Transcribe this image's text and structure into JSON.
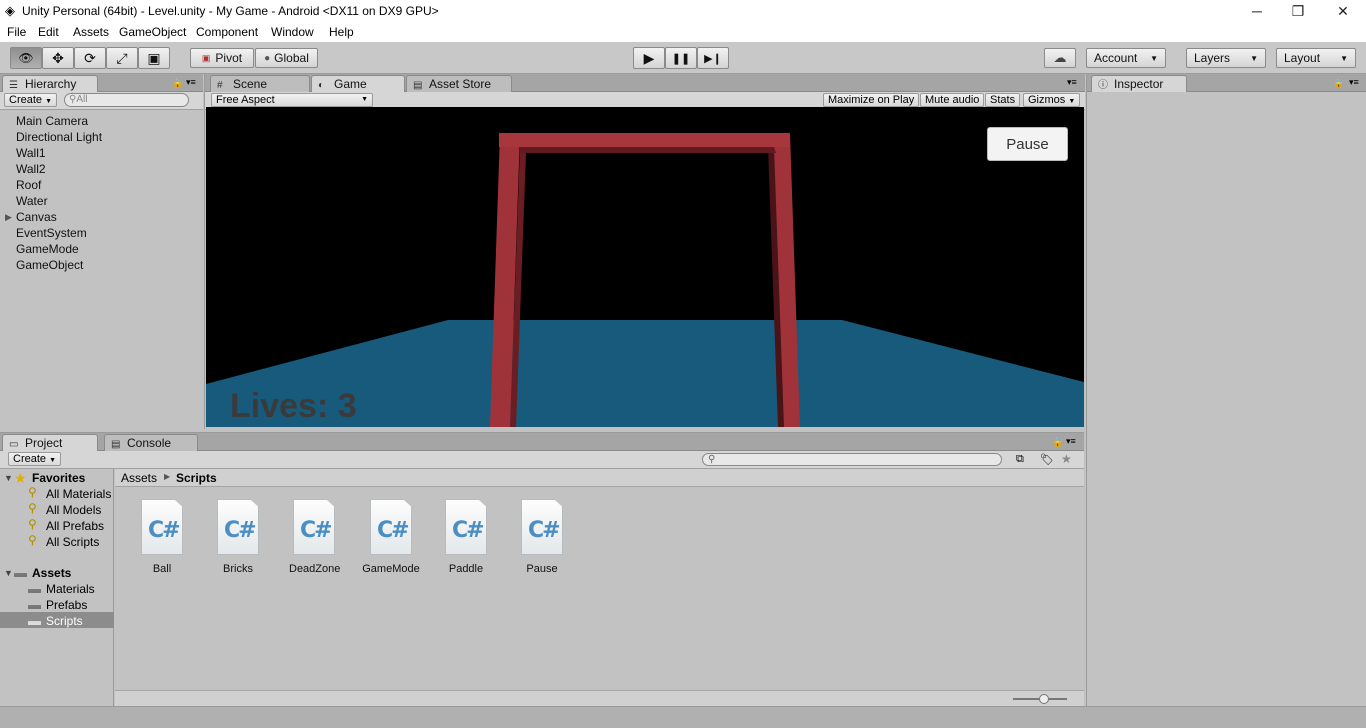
{
  "window": {
    "title": "Unity Personal (64bit) - Level.unity - My Game - Android <DX11 on DX9 GPU>",
    "minimize_glyph": "─",
    "maximize_glyph": "❐",
    "close_glyph": "✕"
  },
  "menu": [
    "File",
    "Edit",
    "Assets",
    "GameObject",
    "Component",
    "Window",
    "Help"
  ],
  "toolbar": {
    "tools": [
      "view-tool",
      "move-tool",
      "rotate-tool",
      "scale-tool",
      "rect-tool"
    ],
    "tool_glyphs": [
      "👁",
      "✥",
      "⟳",
      "⤢",
      "▣"
    ],
    "pivot_label": "Pivot",
    "global_label": "Global",
    "play_glyph": "▶",
    "pause_glyph": "❚❚",
    "step_glyph": "▶❙",
    "cloud_glyph": "☁",
    "account_label": "Account",
    "layers_label": "Layers",
    "layout_label": "Layout"
  },
  "hierarchy": {
    "tab_label": "Hierarchy",
    "create_label": "Create",
    "search_placeholder": "All",
    "items": [
      "Main Camera",
      "Directional Light",
      "Wall1",
      "Wall2",
      "Roof",
      "Water",
      "Canvas",
      "EventSystem",
      "GameMode",
      "GameObject"
    ]
  },
  "center_tabs": {
    "scene": "Scene",
    "game": "Game",
    "asset_store": "Asset Store"
  },
  "game_bar": {
    "aspect": "Free Aspect",
    "maximize": "Maximize on Play",
    "mute": "Mute audio",
    "stats": "Stats",
    "gizmos": "Gizmos"
  },
  "game": {
    "pause_button": "Pause",
    "lives_text": "Lives: 3",
    "colors": {
      "sky": "#000000",
      "water": "#1a5a7a",
      "frame": "#9e2f36"
    }
  },
  "inspector": {
    "tab_label": "Inspector"
  },
  "project": {
    "tab_label": "Project",
    "console_label": "Console",
    "create_label": "Create",
    "favorites_label": "Favorites",
    "favorites": [
      "All Materials",
      "All Models",
      "All Prefabs",
      "All Scripts"
    ],
    "assets_label": "Assets",
    "folders": [
      "Materials",
      "Prefabs",
      "Scripts"
    ],
    "selected_folder": "Scripts",
    "breadcrumb": [
      "Assets",
      "Scripts"
    ],
    "scripts": [
      "Ball",
      "Bricks",
      "DeadZone",
      "GameMode",
      "Paddle",
      "Pause"
    ],
    "cs_glyph": "C#"
  }
}
